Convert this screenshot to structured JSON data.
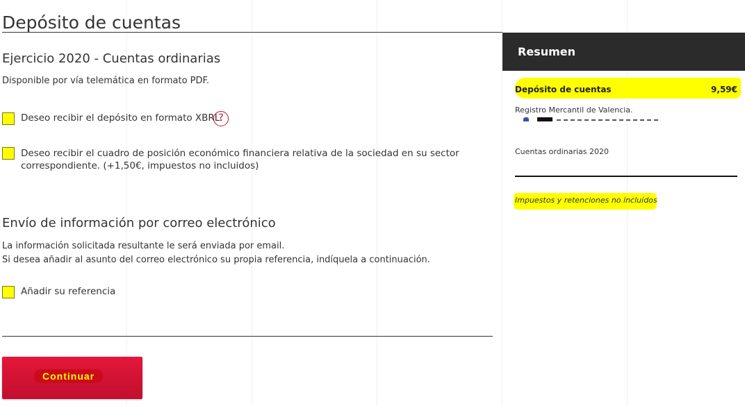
{
  "page": {
    "title": "Depósito de cuentas"
  },
  "exercise": {
    "title": "Ejercicio 2020 - Cuentas ordinarias",
    "availability": "Disponible por vía telemática en formato PDF.",
    "option_xbrl": {
      "label": "Deseo recibir el depósito en formato XBRL.",
      "checked": false
    },
    "help_symbol": "?",
    "option_position_line1": "Deseo recibir el cuadro de posición económico financiera relativa de la sociedad en su sector",
    "option_position_line2": "correspondiente. (+1,50€, impuestos no incluidos)"
  },
  "email": {
    "title": "Envío de información por correo electrónico",
    "line1": "La información solicitada resultante le será enviada por email.",
    "line2": "Si desea añadir al asunto del correo electrónico su propia referencia, indíquela a continuación.",
    "option_reference": {
      "label": "Añadir su referencia",
      "checked": false
    }
  },
  "actions": {
    "continue_label": "Continuar"
  },
  "summary": {
    "title": "Resumen",
    "item_name": "Depósito de cuentas",
    "item_price": "9,59€",
    "registry": "Registro Mercantil de Valencia.",
    "account_type": "Cuentas ordinarias 2020",
    "tax_note": "Impuestos y retenciones no incluidos"
  },
  "colors": {
    "accent_red": "#d0112b",
    "highlight_yellow": "#ffff00",
    "summary_header_bg": "#2b2b2b"
  }
}
